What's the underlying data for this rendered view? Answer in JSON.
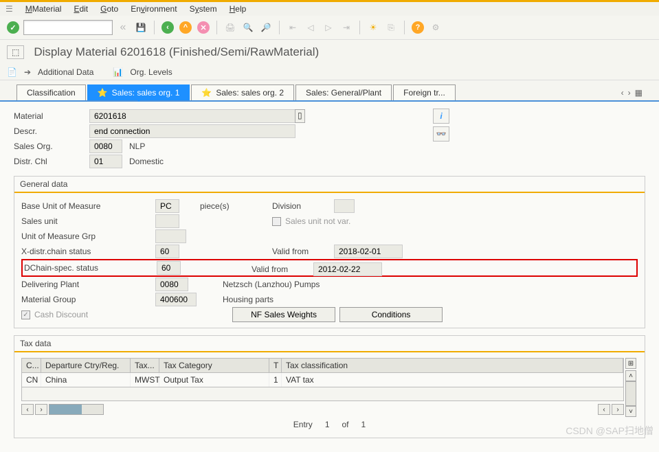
{
  "menu": {
    "material": "Material",
    "edit": "Edit",
    "goto": "Goto",
    "environment": "Environment",
    "system": "System",
    "help": "Help"
  },
  "title": "Display Material 6201618 (Finished/Semi/RawMaterial)",
  "subtool": {
    "additional": "Additional Data",
    "orglevels": "Org. Levels"
  },
  "tabs": {
    "classification": "Classification",
    "sales1": "Sales: sales org. 1",
    "sales2": "Sales: sales org. 2",
    "salesgen": "Sales: General/Plant",
    "foreign": "Foreign tr..."
  },
  "header": {
    "material_label": "Material",
    "material": "6201618",
    "descr_label": "Descr.",
    "descr": "end connection",
    "salesorg_label": "Sales Org.",
    "salesorg": "0080",
    "salesorg_txt": "NLP",
    "distr_label": "Distr. Chl",
    "distr": "01",
    "distr_txt": "Domestic"
  },
  "general": {
    "title": "General data",
    "buom_label": "Base Unit of Measure",
    "buom": "PC",
    "piece": "piece(s)",
    "division_label": "Division",
    "salesunit_label": "Sales unit",
    "suv_label": "Sales unit not var.",
    "uomgrp_label": "Unit of Measure Grp",
    "xdistr_label": "X-distr.chain status",
    "xdistr": "60",
    "valid1_label": "Valid from",
    "valid1": "2018-02-01",
    "dchain_label": "DChain-spec. status",
    "dchain": "60",
    "valid2_label": "Valid from",
    "valid2": "2012-02-22",
    "delplant_label": "Delivering Plant",
    "delplant": "0080",
    "delplant_txt": "Netzsch (Lanzhou) Pumps",
    "matgrp_label": "Material Group",
    "matgrp": "400600",
    "matgrp_txt": "Housing parts",
    "cash_label": "Cash Discount",
    "btn_nf": "NF Sales Weights",
    "btn_cond": "Conditions"
  },
  "tax": {
    "title": "Tax data",
    "h_c": "C...",
    "h_dep": "Departure Ctry/Reg.",
    "h_tax": "Tax...",
    "h_taxcat": "Tax Category",
    "h_t": "T",
    "h_taxclass": "Tax classification",
    "row": {
      "c": "CN",
      "dep": "China",
      "tax": "MWST",
      "taxcat": "Output Tax",
      "t": "1",
      "taxclass": "VAT tax"
    }
  },
  "entry": {
    "label": "Entry",
    "v1": "1",
    "of": "of",
    "v2": "1"
  },
  "watermark": "CSDN @SAP扫地僧"
}
